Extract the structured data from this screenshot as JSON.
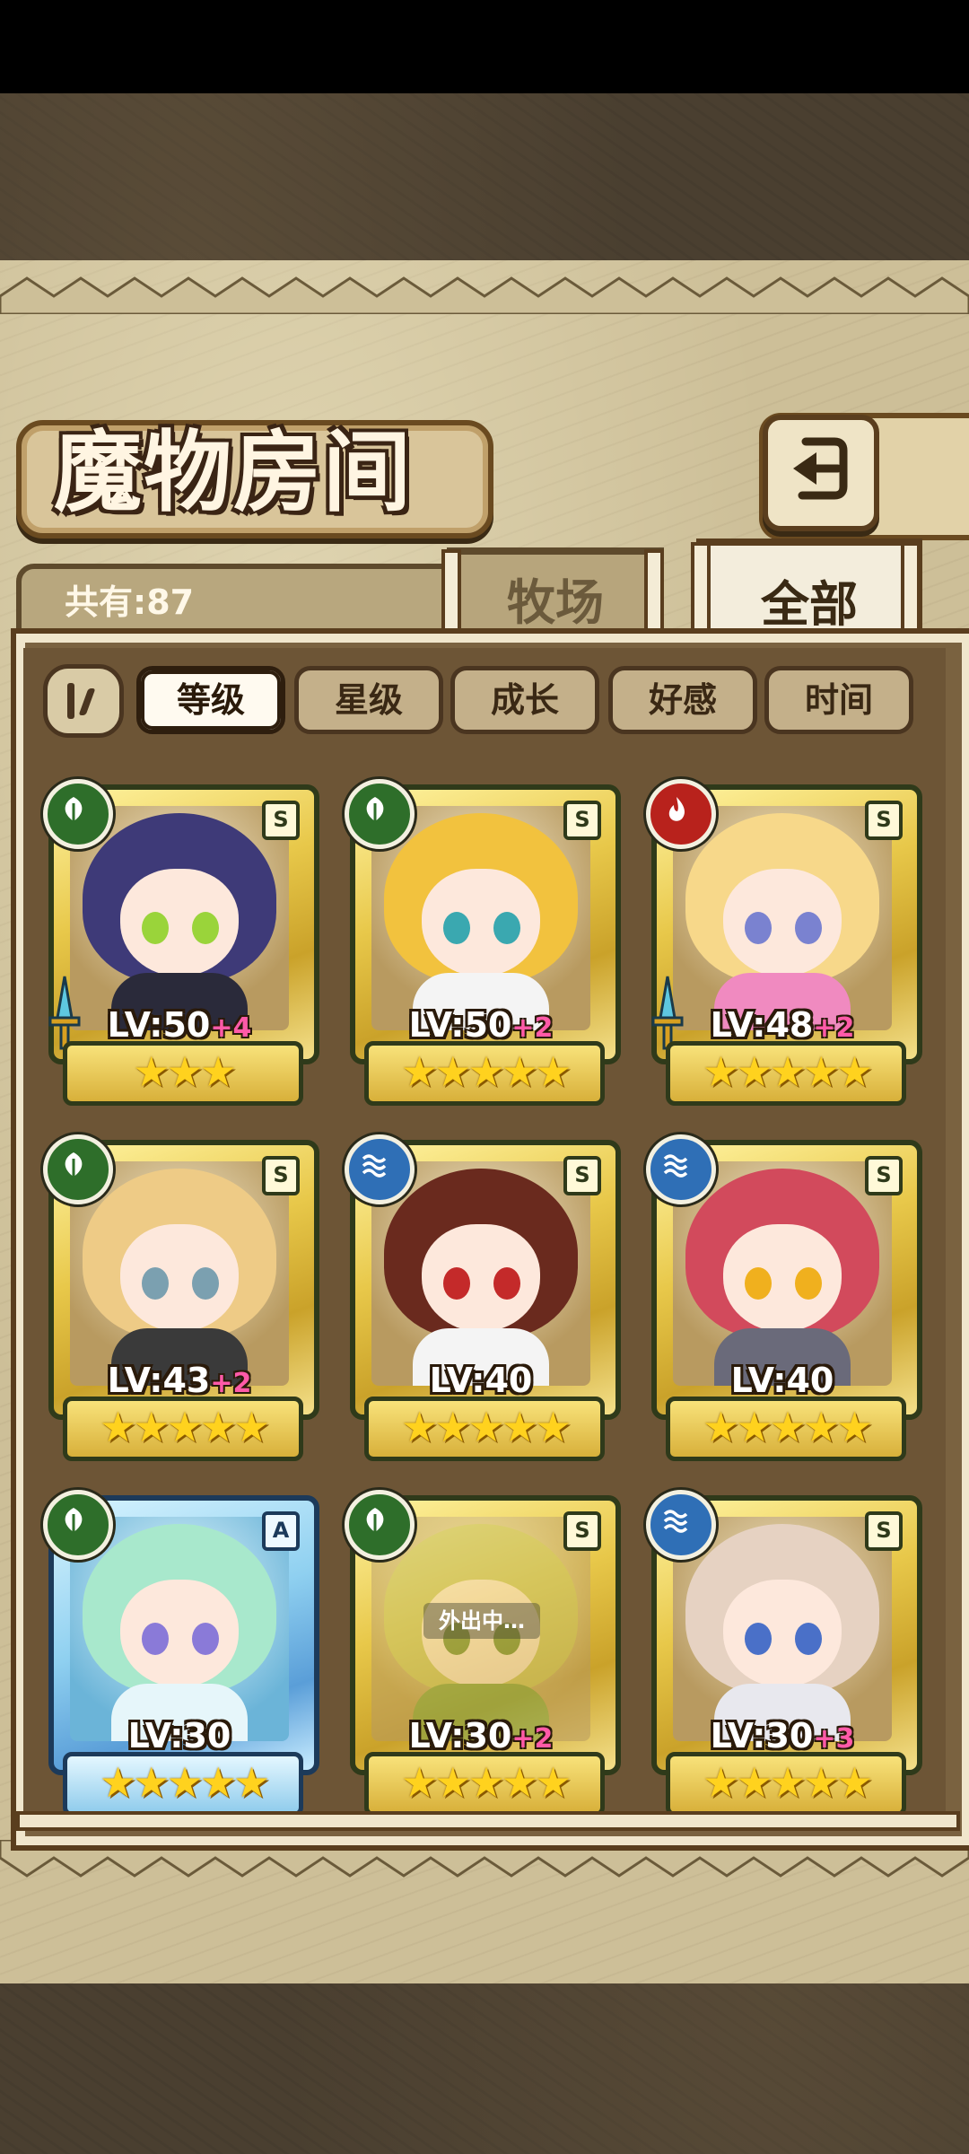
{
  "title": "魔物房间",
  "total": "共有:87",
  "tabs": {
    "ranch": "牧场",
    "all": "全部"
  },
  "sort": {
    "level": "等级",
    "star": "星级",
    "growth": "成长",
    "affinity": "好感",
    "time": "时间"
  },
  "colors": {
    "gold_frame": "#e8c84a",
    "blue_frame": "#8fd0f0",
    "plus_text": "#ff5aa8"
  },
  "cards": [
    {
      "element": "leaf",
      "rank": "S",
      "level": "LV:50",
      "plus": "+4",
      "stars": "★★★",
      "has_sword": true,
      "hair": "#3e3a78",
      "eye": "#9ad43a",
      "body": "#2a2a3a"
    },
    {
      "element": "leaf",
      "rank": "S",
      "level": "LV:50",
      "plus": "+2",
      "stars": "★★★★★",
      "has_sword": false,
      "hair": "#f2c23e",
      "eye": "#3aa8b0",
      "body": "#f4f4f4"
    },
    {
      "element": "fire",
      "rank": "S",
      "level": "LV:48",
      "plus": "+2",
      "stars": "★★★★★",
      "has_sword": true,
      "hair": "#f7d88a",
      "eye": "#7a82d0",
      "body": "#f08ac0"
    },
    {
      "element": "leaf",
      "rank": "S",
      "level": "LV:43",
      "plus": "+2",
      "stars": "★★★★★",
      "has_sword": false,
      "hair": "#eecb86",
      "eye": "#7ba0b0",
      "body": "#3a3a3a"
    },
    {
      "element": "water",
      "rank": "S",
      "level": "LV:40",
      "plus": "",
      "stars": "★★★★★",
      "has_sword": false,
      "hair": "#6a2a1e",
      "eye": "#c42a2a",
      "body": "#f4f4f4"
    },
    {
      "element": "water",
      "rank": "S",
      "level": "LV:40",
      "plus": "",
      "stars": "★★★★★",
      "has_sword": false,
      "hair": "#d24a5c",
      "eye": "#f0b01e",
      "body": "#6a6a7a"
    },
    {
      "element": "leaf",
      "rank": "A",
      "level": "LV:30",
      "plus": "",
      "stars": "★★★★★",
      "has_sword": false,
      "hair": "#a8e8cc",
      "eye": "#8a7ad8",
      "body": "#e6f6fa",
      "frame": "blue"
    },
    {
      "element": "leaf",
      "rank": "S",
      "level": "LV:30",
      "plus": "+2",
      "stars": "★★★★★",
      "has_sword": false,
      "hair": "#c8c46a",
      "eye": "#6a8a3a",
      "body": "#7ea24a",
      "status": "外出中…"
    },
    {
      "element": "water",
      "rank": "S",
      "level": "LV:30",
      "plus": "+3",
      "stars": "★★★★★",
      "has_sword": false,
      "hair": "#e6d2c2",
      "eye": "#4a70c8",
      "body": "#e8e8ee"
    }
  ]
}
